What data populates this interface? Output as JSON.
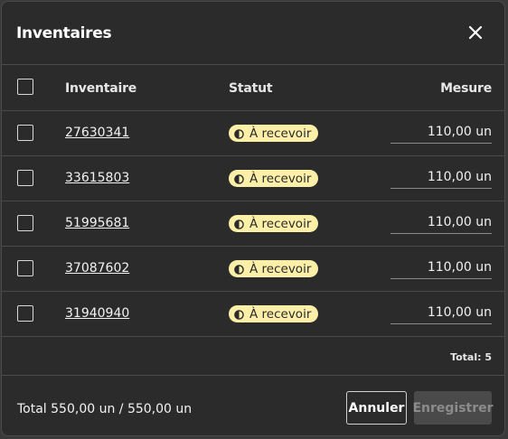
{
  "dialog": {
    "title": "Inventaires",
    "close_icon": "close-icon"
  },
  "table": {
    "headers": {
      "inventaire": "Inventaire",
      "statut": "Statut",
      "mesure": "Mesure"
    },
    "rows": [
      {
        "inventaire": "27630341",
        "statut": "À recevoir",
        "mesure": "110,00 un"
      },
      {
        "inventaire": "33615803",
        "statut": "À recevoir",
        "mesure": "110,00 un"
      },
      {
        "inventaire": "51995681",
        "statut": "À recevoir",
        "mesure": "110,00 un"
      },
      {
        "inventaire": "37087602",
        "statut": "À recevoir",
        "mesure": "110,00 un"
      },
      {
        "inventaire": "31940940",
        "statut": "À recevoir",
        "mesure": "110,00 un"
      }
    ],
    "total_count": "Total: 5"
  },
  "footer": {
    "total": "Total 550,00 un / 550,00 un",
    "cancel_label": "Annuler",
    "save_label": "Enregistrer"
  },
  "colors": {
    "background": "#2b2b2b",
    "badge": "#fcefa8",
    "border": "#4a4a4a"
  }
}
